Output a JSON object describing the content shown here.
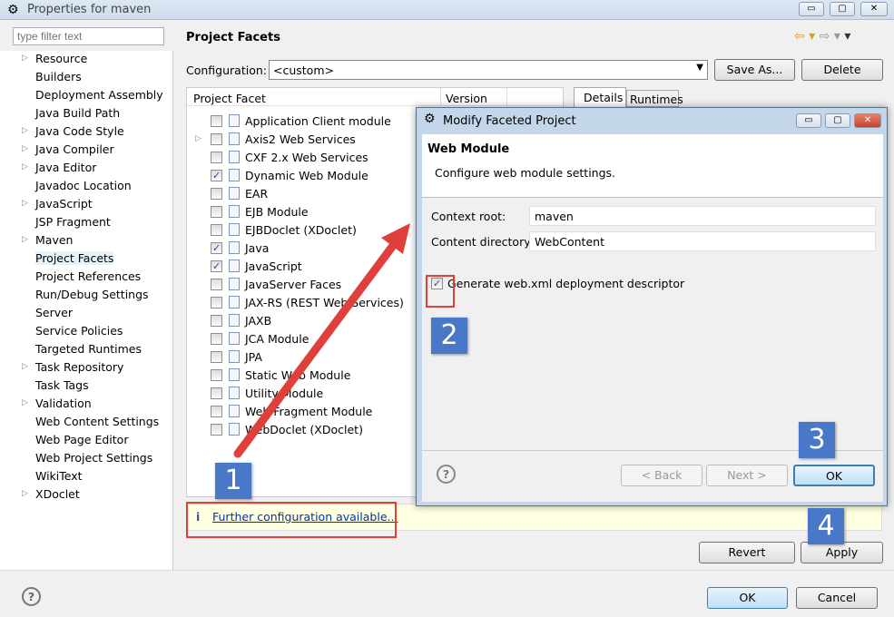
{
  "window": {
    "title": "Properties for maven",
    "min": "▭",
    "max": "▢",
    "close": "✕"
  },
  "filter": {
    "placeholder": "type filter text"
  },
  "sidebar": {
    "items": [
      {
        "label": "Resource",
        "expandable": true
      },
      {
        "label": "Builders"
      },
      {
        "label": "Deployment Assembly"
      },
      {
        "label": "Java Build Path"
      },
      {
        "label": "Java Code Style",
        "expandable": true
      },
      {
        "label": "Java Compiler",
        "expandable": true
      },
      {
        "label": "Java Editor",
        "expandable": true
      },
      {
        "label": "Javadoc Location"
      },
      {
        "label": "JavaScript",
        "expandable": true
      },
      {
        "label": "JSP Fragment"
      },
      {
        "label": "Maven",
        "expandable": true
      },
      {
        "label": "Project Facets",
        "selected": true
      },
      {
        "label": "Project References"
      },
      {
        "label": "Run/Debug Settings"
      },
      {
        "label": "Server"
      },
      {
        "label": "Service Policies"
      },
      {
        "label": "Targeted Runtimes"
      },
      {
        "label": "Task Repository",
        "expandable": true
      },
      {
        "label": "Task Tags"
      },
      {
        "label": "Validation",
        "expandable": true
      },
      {
        "label": "Web Content Settings"
      },
      {
        "label": "Web Page Editor"
      },
      {
        "label": "Web Project Settings"
      },
      {
        "label": "WikiText"
      },
      {
        "label": "XDoclet",
        "expandable": true
      }
    ]
  },
  "page": {
    "title": "Project Facets",
    "config_label": "Configuration:",
    "config_value": "<custom>",
    "save_as": "Save As...",
    "delete": "Delete",
    "col_facet": "Project Facet",
    "col_version": "Version",
    "tab_details": "Details",
    "tab_runtimes": "Runtimes",
    "facets": [
      {
        "label": "Application Client module",
        "checked": false
      },
      {
        "label": "Axis2 Web Services",
        "checked": false,
        "expandable": true
      },
      {
        "label": "CXF 2.x Web Services",
        "checked": false
      },
      {
        "label": "Dynamic Web Module",
        "checked": true
      },
      {
        "label": "EAR",
        "checked": false
      },
      {
        "label": "EJB Module",
        "checked": false
      },
      {
        "label": "EJBDoclet (XDoclet)",
        "checked": false
      },
      {
        "label": "Java",
        "checked": true
      },
      {
        "label": "JavaScript",
        "checked": true
      },
      {
        "label": "JavaServer Faces",
        "checked": false
      },
      {
        "label": "JAX-RS (REST Web Services)",
        "checked": false
      },
      {
        "label": "JAXB",
        "checked": false
      },
      {
        "label": "JCA Module",
        "checked": false
      },
      {
        "label": "JPA",
        "checked": false
      },
      {
        "label": "Static Web Module",
        "checked": false
      },
      {
        "label": "Utility Module",
        "checked": false
      },
      {
        "label": "Web Fragment Module",
        "checked": false
      },
      {
        "label": "WebDoclet (XDoclet)",
        "checked": false
      }
    ],
    "info_icon": "i",
    "info_link": "Further configuration available...",
    "revert": "Revert",
    "apply": "Apply"
  },
  "footer": {
    "ok": "OK",
    "cancel": "Cancel"
  },
  "dialog": {
    "title": "Modify Faceted Project",
    "heading": "Web Module",
    "description": "Configure web module settings.",
    "context_root_label": "Context root:",
    "context_root": "maven",
    "content_dir_label": "Content directory:",
    "content_dir": "WebContent",
    "generate_label": "Generate web.xml deployment descriptor",
    "generate_checked": true,
    "back": "< Back",
    "next": "Next >",
    "ok": "OK"
  },
  "annotations": {
    "step1": "1",
    "step2": "2",
    "step3": "3",
    "step4": "4",
    "color": "#e0403c",
    "badge_color": "#4a78c8"
  }
}
